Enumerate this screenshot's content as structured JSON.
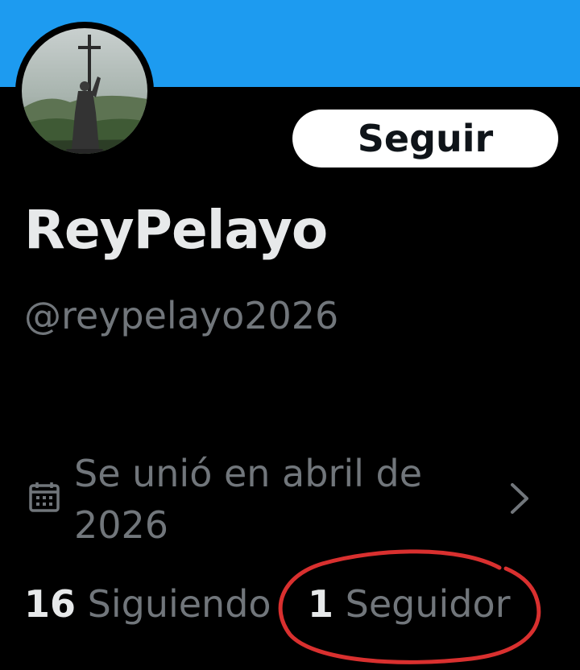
{
  "profile": {
    "display_name": "ReyPelayo",
    "handle": "@reypelayo2026",
    "follow_label": "Seguir",
    "joined": "Se unió en abril de 2026",
    "following_count": "16",
    "following_label": "Siguiendo",
    "followers_count": "1",
    "followers_label": "Seguidor"
  },
  "icons": {
    "calendar": "calendar-icon",
    "chevron": "chevron-right-icon"
  },
  "colors": {
    "banner": "#1d9bf0",
    "background": "#000000",
    "primary_text": "#e7e9ea",
    "secondary_text": "#71767b",
    "annotation": "#d9302f"
  }
}
